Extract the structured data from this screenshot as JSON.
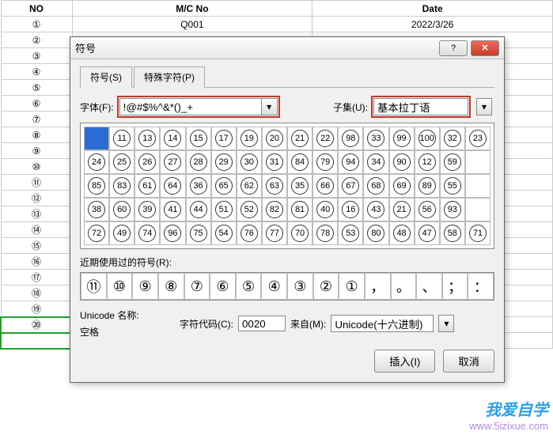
{
  "sheet": {
    "headers": [
      "NO",
      "M/C No",
      "Date"
    ],
    "rows": [
      {
        "no": "①",
        "mc": "Q001",
        "date": "2022/3/26"
      },
      {
        "no": "②",
        "mc": "",
        "date": ""
      },
      {
        "no": "③",
        "mc": "",
        "date": ""
      },
      {
        "no": "④",
        "mc": "",
        "date": ""
      },
      {
        "no": "⑤",
        "mc": "",
        "date": ""
      },
      {
        "no": "⑥",
        "mc": "",
        "date": ""
      },
      {
        "no": "⑦",
        "mc": "",
        "date": ""
      },
      {
        "no": "⑧",
        "mc": "",
        "date": ""
      },
      {
        "no": "⑨",
        "mc": "",
        "date": ""
      },
      {
        "no": "⑩",
        "mc": "",
        "date": ""
      },
      {
        "no": "⑪",
        "mc": "",
        "date": ""
      },
      {
        "no": "⑫",
        "mc": "",
        "date": ""
      },
      {
        "no": "⑬",
        "mc": "",
        "date": ""
      },
      {
        "no": "⑭",
        "mc": "",
        "date": ""
      },
      {
        "no": "⑮",
        "mc": "",
        "date": ""
      },
      {
        "no": "⑯",
        "mc": "",
        "date": ""
      },
      {
        "no": "⑰",
        "mc": "",
        "date": ""
      },
      {
        "no": "⑱",
        "mc": "",
        "date": ""
      },
      {
        "no": "⑲",
        "mc": "",
        "date": ""
      },
      {
        "no": "⑳",
        "mc": "",
        "date": ""
      }
    ]
  },
  "dialog": {
    "title": "符号",
    "help": "?",
    "close": "✕",
    "tabs": {
      "symbols": "符号(S)",
      "special": "特殊字符(P)"
    },
    "font_label": "字体(F):",
    "font_value": "!@#$%^&*()_+",
    "subset_label": "子集(U):",
    "subset_value": "基本拉丁语",
    "grid": [
      [
        "",
        "11",
        "13",
        "14",
        "15",
        "17",
        "19",
        "20",
        "21",
        "22",
        "98",
        "33",
        "99",
        "100",
        "32",
        "23"
      ],
      [
        "24",
        "25",
        "26",
        "27",
        "28",
        "29",
        "30",
        "31",
        "84",
        "79",
        "94",
        "34",
        "90",
        "12",
        "59",
        ""
      ],
      [
        "85",
        "83",
        "61",
        "64",
        "36",
        "65",
        "62",
        "63",
        "35",
        "66",
        "67",
        "68",
        "69",
        "89",
        "55",
        ""
      ],
      [
        "38",
        "60",
        "39",
        "41",
        "44",
        "51",
        "52",
        "82",
        "81",
        "40",
        "16",
        "43",
        "21",
        "56",
        "93",
        ""
      ],
      [
        "72",
        "49",
        "74",
        "96",
        "75",
        "54",
        "76",
        "77",
        "70",
        "78",
        "53",
        "80",
        "48",
        "47",
        "58",
        "71"
      ]
    ],
    "recent_label": "近期使用过的符号(R):",
    "recent": [
      "⑪",
      "⑩",
      "⑨",
      "⑧",
      "⑦",
      "⑥",
      "⑤",
      "④",
      "③",
      "②",
      "①",
      "，",
      "。",
      "、",
      "；",
      "："
    ],
    "unicode_name_label": "Unicode 名称:",
    "unicode_name": "空格",
    "charcode_label": "字符代码(C):",
    "charcode_value": "0020",
    "from_label": "来自(M):",
    "from_value": "Unicode(十六进制)",
    "insert": "插入(I)",
    "cancel": "取消"
  },
  "watermark": {
    "cn": "我爱自学",
    "url": "www.5izixue.com"
  }
}
